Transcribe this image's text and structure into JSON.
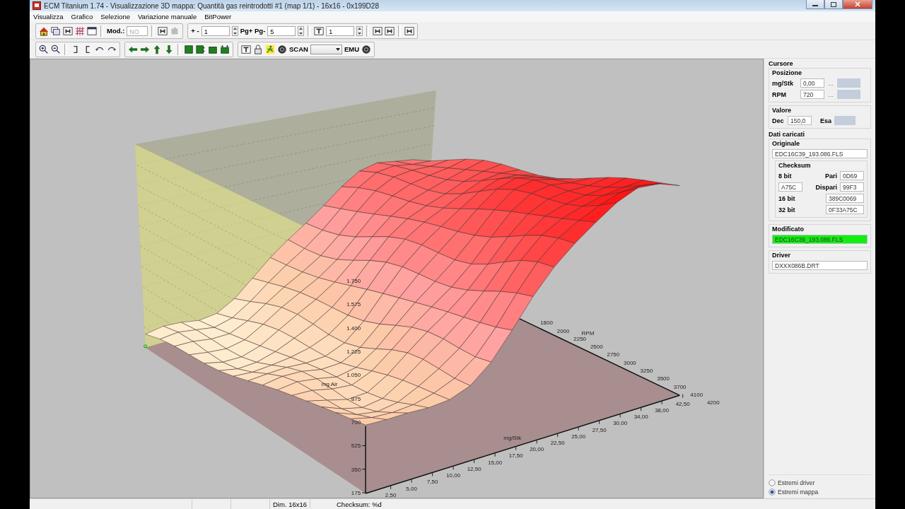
{
  "window": {
    "title": "ECM Titanium 1.74 - Visualizzazione 3D mappa: Quantità gas reintrodotti #1 (map 1/1) - 16x16 - 0x199D28"
  },
  "menu": [
    "Visualizza",
    "Grafico",
    "Selezione",
    "Variazione manuale",
    "BitPower"
  ],
  "toolbar": {
    "mod_label": "Mod.:",
    "mod_value": "NO",
    "mod_disabled": true,
    "step_label": "+ -",
    "step_value": "1",
    "page_label": "Pg+ Pg-",
    "page_value": "5",
    "p_value": "1",
    "scan_label": "SCAN",
    "emu_label": "EMU"
  },
  "plot": {
    "z_label": "mg Air",
    "z_ticks": [
      "1.750",
      "1.575",
      "1.400",
      "1.225",
      "1.050",
      "875",
      "700",
      "525",
      "350",
      "175"
    ],
    "x_label": "mg/Stk",
    "x_ticks": [
      "2,50",
      "5,00",
      "7,50",
      "10,00",
      "12,50",
      "15,00",
      "17,50",
      "20,00",
      "22,50",
      "25,00",
      "27,50",
      "30,00",
      "34,00",
      "38,00",
      "42,50"
    ],
    "y_label": "RPM",
    "y_ticks": [
      "1800",
      "2000",
      "2250",
      "2500",
      "2750",
      "3000",
      "3250",
      "3500",
      "3700",
      "4100",
      "4200"
    ]
  },
  "cursor": {
    "title": "Cursore",
    "position_title": "Posizione",
    "fields": [
      {
        "label": "mg/Stk",
        "value": "0,00",
        "more": "..."
      },
      {
        "label": "RPM",
        "value": "720",
        "more": "..."
      }
    ],
    "value_title": "Valore",
    "dec_label": "Dec",
    "dec_value": "150,0",
    "hex_label": "Esa"
  },
  "loaded": {
    "title": "Dati caricati",
    "original_title": "Originale",
    "original_file": "EDC16C39_193.086.FLS",
    "checksum_title": "Checksum",
    "bit8_label": "8 bit",
    "bit8_value": "A75C",
    "pari_label": "Pari",
    "pari_value": "0D69",
    "dispari_label": "Dispari",
    "dispari_value": "99F3",
    "bit16_label": "16 bit",
    "bit16_value": "389C0069",
    "bit32_label": "32 bit",
    "bit32_value": "0F33A75C",
    "modified_title": "Modificato",
    "modified_file": "EDC16C39_193.086.FLS",
    "modified_highlight": true,
    "driver_title": "Driver",
    "driver_file": "DXXX086B.DRT"
  },
  "range_options": [
    {
      "label": "Estremi driver",
      "selected": false
    },
    {
      "label": "Estremi mappa",
      "selected": true
    }
  ],
  "status_bar": [
    "Dim. 16x16",
    "Checksum: %d"
  ]
}
